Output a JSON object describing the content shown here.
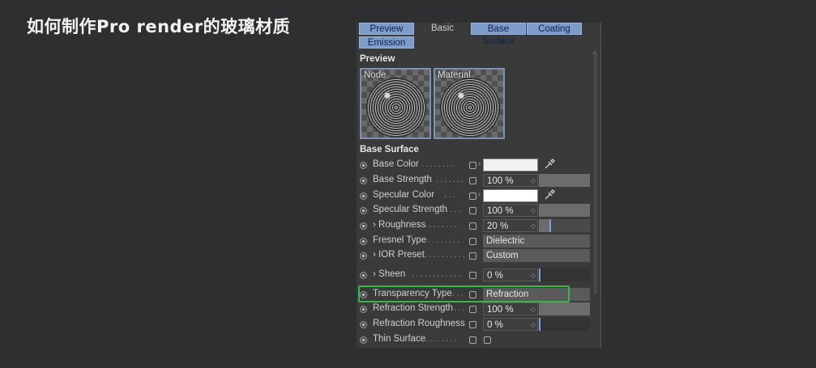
{
  "slide_title": "如何制作Pro render的玻璃材质",
  "tabs": [
    {
      "label": "Preview",
      "active": true
    },
    {
      "label": "Basic",
      "active": false
    },
    {
      "label": "Base Surface",
      "active": true
    },
    {
      "label": "Coating",
      "active": true
    },
    {
      "label": "Emission",
      "active": true
    }
  ],
  "preview": {
    "section_title": "Preview",
    "node_label": "Node",
    "material_label": "Material"
  },
  "base_surface": {
    "section_title": "Base Surface",
    "params": {
      "base_color": {
        "label": "Base Color",
        "dots": "........",
        "icon": "eyedropper-icon",
        "value_color": "#f1f1f1"
      },
      "base_strength": {
        "label": "Base Strength",
        "dots": ".......",
        "value": "100 %",
        "level": 1.0
      },
      "specular_color": {
        "label": "Specular Color",
        "dots": "...",
        "icon": "eyedropper-icon",
        "value_color": "#ffffff"
      },
      "specular_strength": {
        "label": "Specular Strength",
        "dots": "....",
        "value": "100 %",
        "level": 1.0
      },
      "roughness": {
        "label": "› Roughness",
        "dots": "........",
        "value": "20 %",
        "level": 0.2
      },
      "fresnel_type": {
        "label": "Fresnel Type",
        "dots": "........",
        "value": "Dielectric"
      },
      "ior_preset": {
        "label": "› IOR Preset",
        "dots": "..........",
        "value": "Custom"
      },
      "sheen": {
        "label": "› Sheen",
        "dots": "............",
        "value": "0 %",
        "level": 0.0
      },
      "transparency_type": {
        "label": "Transparency Type",
        "dots": "...",
        "value": "Refraction",
        "highlighted": true,
        "highlight_color": "#3ab54a"
      },
      "refraction_strength": {
        "label": "Refraction Strength",
        "dots": "...",
        "value": "100 %",
        "level": 1.0
      },
      "refraction_roughness": {
        "label": "Refraction Roughness",
        "dots": "",
        "value": "0 %",
        "level": 0.0
      },
      "thin_surface": {
        "label": "Thin Surface",
        "dots": "........",
        "checked": false
      }
    }
  },
  "accent_color": "#7d9cc8"
}
